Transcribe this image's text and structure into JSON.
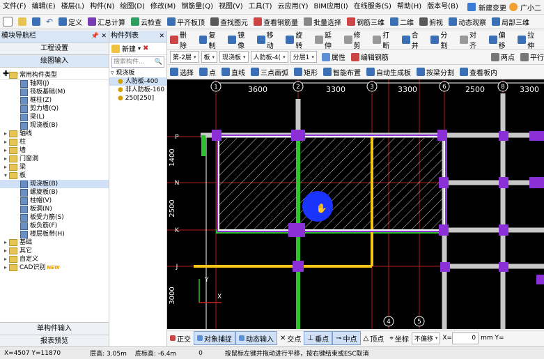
{
  "menubar": {
    "items": [
      "文件(F)",
      "编辑(E)",
      "楼层(L)",
      "构件(N)",
      "绘图(D)",
      "修改(M)",
      "钢筋量(Q)",
      "视图(V)",
      "工具(T)",
      "云应用(Y)",
      "BIM应用(I)",
      "在线服务(S)",
      "帮助(H)",
      "版本号(B)"
    ],
    "new_change": "新建变更",
    "user": "广小二"
  },
  "toolbar1": {
    "items": [
      "定义",
      "汇总计算",
      "云检查",
      "平齐板顶",
      "查找图元",
      "查看钢筋量",
      "批量选择",
      "钢筋三维",
      "二维",
      "俯视",
      "动态观察",
      "局部三维"
    ]
  },
  "nav": {
    "title": "模块导航栏",
    "project_settings": "工程设置",
    "drawing_input": "绘图输入",
    "single_input": "单构件输入",
    "report_preview": "报表预览",
    "tree": [
      {
        "label": "常用构件类型",
        "type": "folder",
        "level": 0,
        "expanded": true
      },
      {
        "label": "轴网(J)",
        "type": "leaf",
        "level": 1
      },
      {
        "label": "筏板基础(M)",
        "type": "leaf",
        "level": 1
      },
      {
        "label": "框柱(Z)",
        "type": "leaf",
        "level": 1
      },
      {
        "label": "剪力墙(Q)",
        "type": "leaf",
        "level": 1
      },
      {
        "label": "梁(L)",
        "type": "leaf",
        "level": 1
      },
      {
        "label": "现浇板(B)",
        "type": "leaf",
        "level": 1
      },
      {
        "label": "轴线",
        "type": "folder",
        "level": 0
      },
      {
        "label": "柱",
        "type": "folder",
        "level": 0
      },
      {
        "label": "墙",
        "type": "folder",
        "level": 0
      },
      {
        "label": "门窗洞",
        "type": "folder",
        "level": 0
      },
      {
        "label": "梁",
        "type": "folder",
        "level": 0
      },
      {
        "label": "板",
        "type": "folder",
        "level": 0,
        "expanded": true
      },
      {
        "label": "现浇板(B)",
        "type": "leaf",
        "level": 1,
        "selected": true
      },
      {
        "label": "螺旋板(B)",
        "type": "leaf",
        "level": 1
      },
      {
        "label": "柱帽(V)",
        "type": "leaf",
        "level": 1
      },
      {
        "label": "板洞(N)",
        "type": "leaf",
        "level": 1
      },
      {
        "label": "板受力筋(S)",
        "type": "leaf",
        "level": 1
      },
      {
        "label": "板负筋(F)",
        "type": "leaf",
        "level": 1
      },
      {
        "label": "楼层板带(H)",
        "type": "leaf",
        "level": 1
      },
      {
        "label": "基础",
        "type": "folder",
        "level": 0
      },
      {
        "label": "其它",
        "type": "folder",
        "level": 0
      },
      {
        "label": "自定义",
        "type": "folder",
        "level": 0
      },
      {
        "label": "CAD识别",
        "type": "folder",
        "level": 0,
        "badge": "NEW"
      }
    ]
  },
  "list": {
    "title": "构件列表",
    "new_label": "新建",
    "search_placeholder": "搜索构件...",
    "items": [
      "现浇板",
      "人防板-400",
      "非人防板-160",
      "250[250]"
    ]
  },
  "toolbar2": {
    "items": [
      "删除",
      "复制",
      "镜像",
      "移动",
      "旋转",
      "延伸",
      "修剪",
      "打断",
      "合并",
      "分割",
      "对齐",
      "偏移",
      "拉伸"
    ]
  },
  "toolbar3": {
    "floor": "第-2层",
    "category": "板",
    "subtype": "现浇板",
    "component": "人防板-4(",
    "layer": "分层1",
    "attr_label": "属性",
    "edit_rebar": "编辑钢筋",
    "two_points": "两点",
    "parallel": "平行"
  },
  "toolbar4": {
    "items": [
      "选择",
      "点",
      "直线",
      "三点画弧",
      "矩形",
      "智能布置",
      "自动生成板",
      "按梁分割",
      "查看板内"
    ]
  },
  "canvas": {
    "top_dims": [
      "3600",
      "3300",
      "3300",
      "2500",
      "3300"
    ],
    "axis_top": [
      "1",
      "2",
      "3",
      "6",
      "7",
      "8"
    ],
    "axis_bottom": [
      "4",
      "5"
    ],
    "axis_left": [
      "P",
      "N",
      "K",
      "J"
    ],
    "left_dims": [
      "1400",
      "2500",
      "3000"
    ]
  },
  "snapbar": {
    "ortho": "正交",
    "obj_snap": "对象捕捉",
    "dyn_input": "动态输入",
    "intersection": "交点",
    "perpendicular": "垂点",
    "midpoint": "中点",
    "vertex": "顶点",
    "coord": "坐标",
    "no_offset": "不偏移",
    "x_label": "X=",
    "x_value": "0",
    "unit": "mm Y="
  },
  "status": {
    "coords": "X=4507 Y=11870",
    "floor_height": "层高: 3.05m",
    "bottom_elev": "底标高: -6.4m",
    "value": "0",
    "hint": "按鼠标左键并拖动进行平移，按右键结束或ESC取消"
  },
  "colors": {
    "column": "#8b2fd6",
    "beam_gray": "#c8c8c8",
    "green": "#2fc22f",
    "yellow": "#f5c518",
    "slab_border": "#ffffff",
    "axis_red": "#cc2222",
    "cursor_blue": "#1a33ff"
  }
}
